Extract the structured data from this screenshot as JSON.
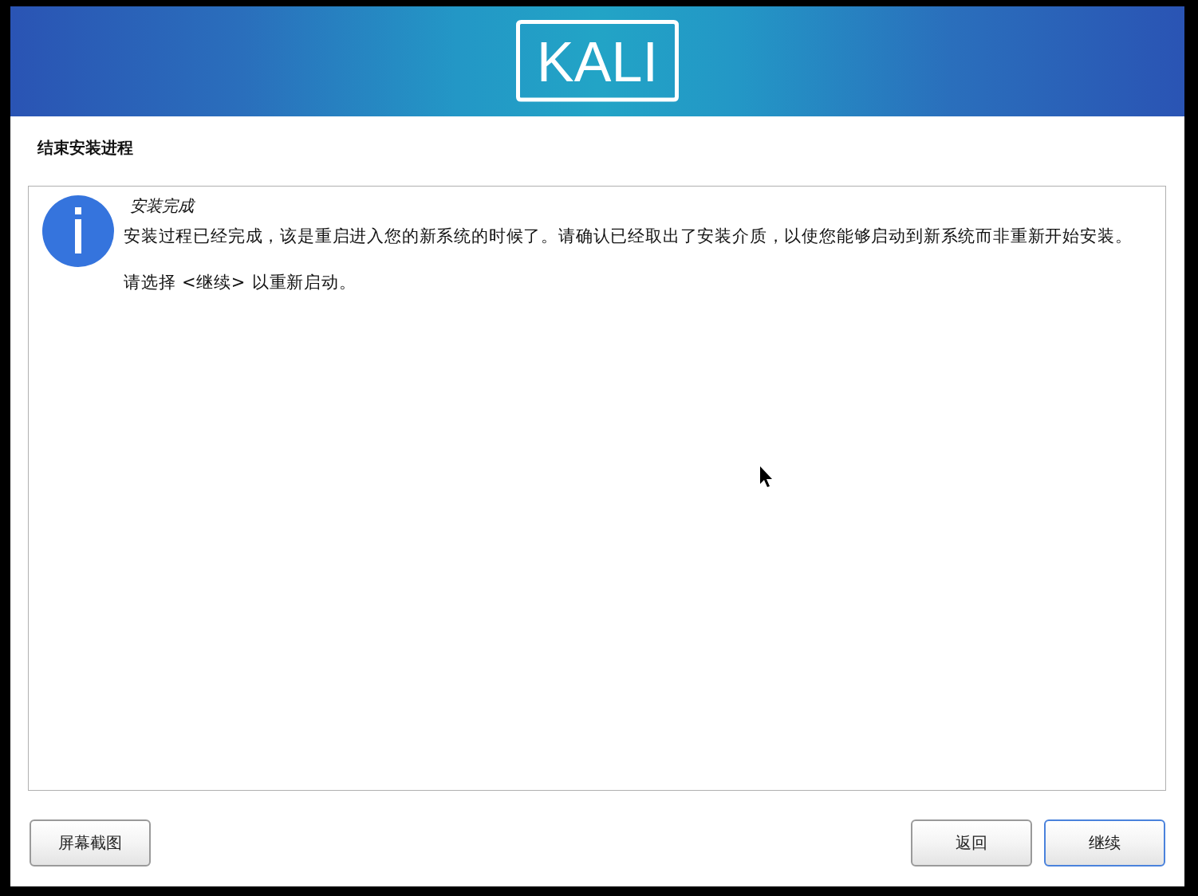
{
  "header": {
    "logo": "KALI"
  },
  "page_title": "结束安装进程",
  "message": {
    "kind": "info",
    "title": "安装完成",
    "paragraphs": [
      "安装过程已经完成，该是重启进入您的新系统的时候了。请确认已经取出了安装介质，以使您能够启动到新系统而非重新开始安装。",
      "请选择 <继续> 以重新启动。"
    ]
  },
  "left_buttons": [
    {
      "label": "屏幕截图",
      "focused": false
    }
  ],
  "right_buttons": [
    {
      "label": "返回",
      "focused": false
    },
    {
      "label": "继续",
      "focused": true
    }
  ]
}
